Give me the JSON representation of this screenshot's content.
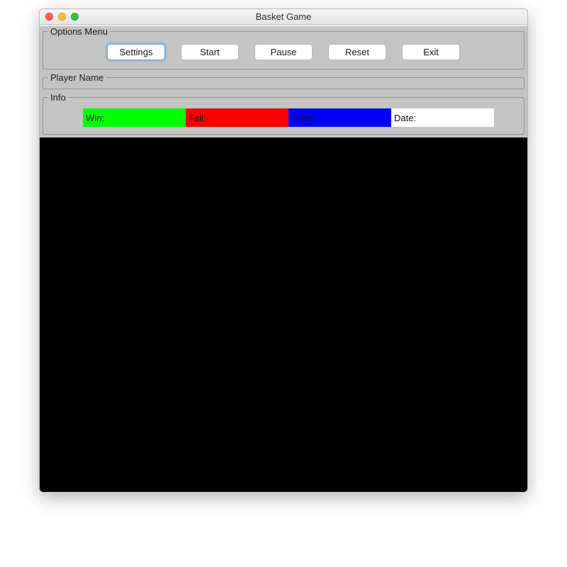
{
  "window": {
    "title": "Basket Game"
  },
  "groups": {
    "options_menu": "Options Menu",
    "player_name": "Player Name",
    "info": "Info"
  },
  "buttons": {
    "settings": "Settings",
    "start": "Start",
    "pause": "Pause",
    "reset": "Reset",
    "exit": "Exit"
  },
  "info": {
    "win_label": "Win:",
    "fail_label": "Fail:",
    "time_label": "Time:",
    "date_label": "Date:"
  }
}
